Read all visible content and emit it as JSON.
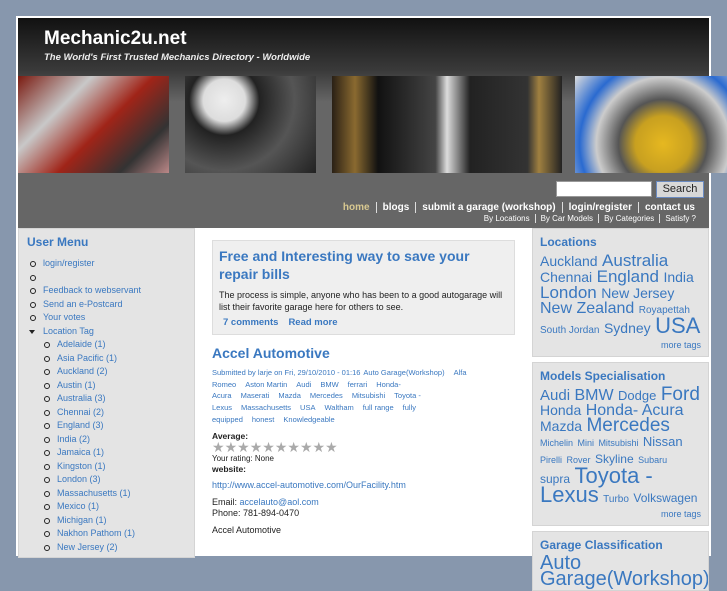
{
  "header": {
    "site_name": "Mechanic2u.net",
    "slogan": "The World's First Trusted Mechanics Directory - Worldwide",
    "search_placeholder": "",
    "search_button": "Search"
  },
  "nav": [
    "home",
    "blogs",
    "submit a garage (workshop)",
    "login/register",
    "contact us"
  ],
  "subnav": [
    "By Locations",
    "By Car Models",
    "By Categories",
    "Satisfy ?"
  ],
  "user_menu": {
    "title": "User Menu",
    "items": [
      "login/register",
      "",
      "Feedback to webservant",
      "Send an e-Postcard",
      "Your votes"
    ],
    "location_tag": "Location Tag",
    "locations": [
      "Adelaide (1)",
      "Asia Pacific (1)",
      "Auckland (2)",
      "Austin (1)",
      "Australia (3)",
      "Chennai (2)",
      "England (3)",
      "India (2)",
      "Jamaica (1)",
      "Kingston (1)",
      "London (3)",
      "Massachusetts (1)",
      "Mexico (1)",
      "Michigan (1)",
      "Nakhon Pathom (1)",
      "New Jersey (2)"
    ]
  },
  "promo": {
    "title": "Free and Interesting way to save your repair bills",
    "body": "The process is simple, anyone who has been to a good autogarage will list their favorite garage here for others to see.",
    "comments": "7 comments",
    "read_more": "Read more"
  },
  "node": {
    "title": "Accel Automotive",
    "submitted": "Submitted by larje on Fri, 29/10/2010 - 01:16",
    "tags": [
      "Auto Garage(Workshop)",
      "Alfa Romeo",
      "Aston Martin",
      "Audi",
      "BMW",
      "ferrari",
      "Honda- Acura",
      "Maserati",
      "Mazda",
      "Mercedes",
      "Mitsubishi",
      "Toyota - Lexus",
      "Massachusetts",
      "USA",
      "Waltham",
      "full range",
      "fully equipped",
      "honest",
      "Knowledgeable"
    ],
    "average_label": "Average:",
    "your_rating": "Your rating: None",
    "website_label": "website:",
    "website": "http://www.accel-automotive.com/OurFacility.htm",
    "email_label": "Email:",
    "email": "accelauto@aol.com",
    "phone": "Phone: 781-894-0470",
    "footer_name": "Accel Automotive",
    "stars": 10,
    "rating": 0
  },
  "locations_box": {
    "title": "Locations",
    "tags": [
      [
        "Auckland",
        14
      ],
      [
        "Australia",
        17
      ],
      [
        "Chennai",
        14
      ],
      [
        "England",
        17
      ],
      [
        "India",
        14
      ],
      [
        "London",
        17
      ],
      [
        "New Jersey",
        14
      ],
      [
        "New Zealand",
        16
      ],
      [
        "Royapettah",
        10
      ],
      [
        "South Jordan",
        10
      ],
      [
        "Sydney",
        14
      ],
      [
        "USA",
        22
      ]
    ],
    "more": "more tags"
  },
  "models_box": {
    "title": "Models Specialisation",
    "tags": [
      [
        "Audi",
        15
      ],
      [
        "BMW",
        16
      ],
      [
        "Dodge",
        13
      ],
      [
        "Ford",
        19
      ],
      [
        "Honda",
        14
      ],
      [
        "Honda- Acura",
        16
      ],
      [
        "Mazda",
        14
      ],
      [
        "Mercedes",
        19
      ],
      [
        "Michelin",
        9
      ],
      [
        "Mini",
        9
      ],
      [
        "Mitsubishi",
        9
      ],
      [
        "Nissan",
        13
      ],
      [
        "Pirelli",
        9
      ],
      [
        "Rover",
        9
      ],
      [
        "Skyline",
        12
      ],
      [
        "Subaru",
        9
      ],
      [
        "supra",
        12
      ],
      [
        "Toyota - Lexus",
        22
      ],
      [
        "Turbo",
        10
      ],
      [
        "Volkswagen",
        12
      ]
    ],
    "more": "more tags"
  },
  "garage_box": {
    "title": "Garage Classification",
    "tags": [
      [
        "Auto Garage(Workshop)",
        20
      ]
    ]
  }
}
